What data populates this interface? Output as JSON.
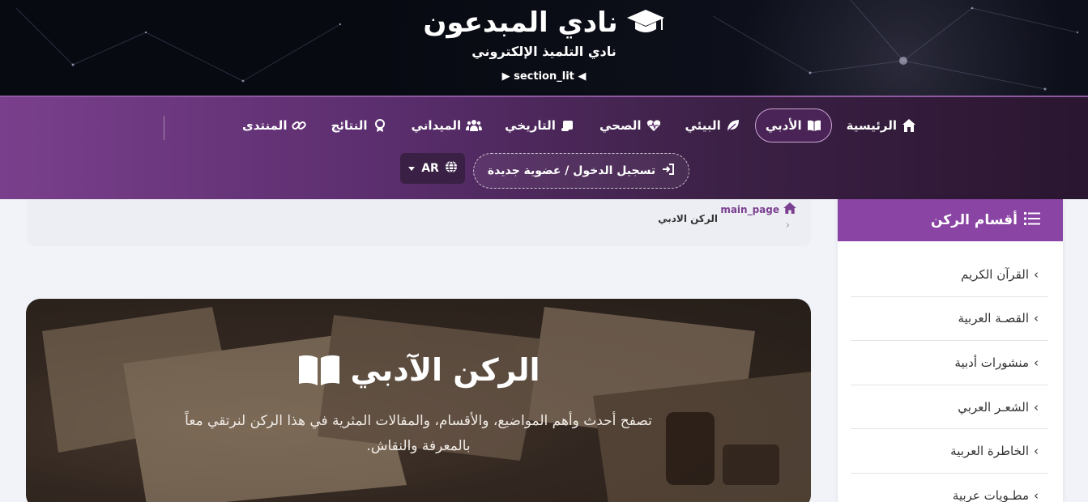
{
  "header": {
    "title": "نادي المبدعون",
    "subtitle": "نادي التلميذ الإلكتروني",
    "section_label": "section_lit",
    "cap_icon": "graduation-cap-icon"
  },
  "nav": {
    "items": [
      {
        "label": "الرئيسية",
        "icon": "home-icon"
      },
      {
        "label": "الأدبي",
        "icon": "book-open-icon",
        "active": true
      },
      {
        "label": "البيئي",
        "icon": "leaf-icon"
      },
      {
        "label": "الصحي",
        "icon": "heart-pulse-icon"
      },
      {
        "label": "التاريخي",
        "icon": "scroll-icon"
      },
      {
        "label": "الميداني",
        "icon": "users-icon"
      },
      {
        "label": "النتائج",
        "icon": "award-icon"
      },
      {
        "label": "المنتدى",
        "icon": "link-icon"
      }
    ],
    "login_label": "تسجيل الدخول / عضوية جديدة",
    "lang_label": "AR"
  },
  "breadcrumb": {
    "home_label": "main_page",
    "current_label": "الركن الادبي",
    "separator": "›"
  },
  "hero": {
    "title": "الركن الآدبي",
    "description": "تصفح أحدث وأهم المواضيع، والأقسام، والمقالات المثرية في هذا الركن لنرتقي معاً بالمعرفة والنقاش."
  },
  "sidebar": {
    "title": "أقسام الركن",
    "items": [
      {
        "label": "القرآن الكريم"
      },
      {
        "label": "القصـة العربية"
      },
      {
        "label": "منشورات أدبية"
      },
      {
        "label": "الشعـر العربي"
      },
      {
        "label": "الخاطرة العربية"
      },
      {
        "label": "مطـويات عربية"
      }
    ]
  },
  "colors": {
    "nav_gradient_start": "#7a3f8c",
    "nav_gradient_end": "#2a1630",
    "sidebar_header": "#8a44a3",
    "accent_link": "#7b3f8f"
  }
}
